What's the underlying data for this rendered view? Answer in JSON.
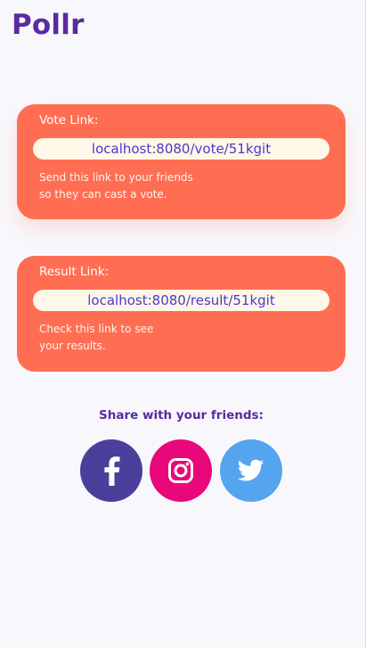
{
  "app": {
    "title": "Pollr"
  },
  "vote_card": {
    "label": "Vote Link:",
    "link": "localhost:8080/vote/51kgit",
    "help_line1": "Send this link to your friends",
    "help_line2": "so they can cast a vote."
  },
  "result_card": {
    "label": "Result Link:",
    "link": "localhost:8080/result/51kgit",
    "help_line1": "Check this link to see",
    "help_line2": "your results."
  },
  "share": {
    "title": "Share with your friends:",
    "buttons": [
      {
        "icon": "facebook-icon",
        "color": "#4a3f9a"
      },
      {
        "icon": "instagram-icon",
        "color": "#e8087a"
      },
      {
        "icon": "twitter-icon",
        "color": "#55a4ef"
      }
    ]
  },
  "colors": {
    "brand": "#5a2aa0",
    "card": "#ff6e52",
    "link_bg": "#fff8e8",
    "link_text": "#4a3ac8",
    "background": "#f8f8fc"
  }
}
